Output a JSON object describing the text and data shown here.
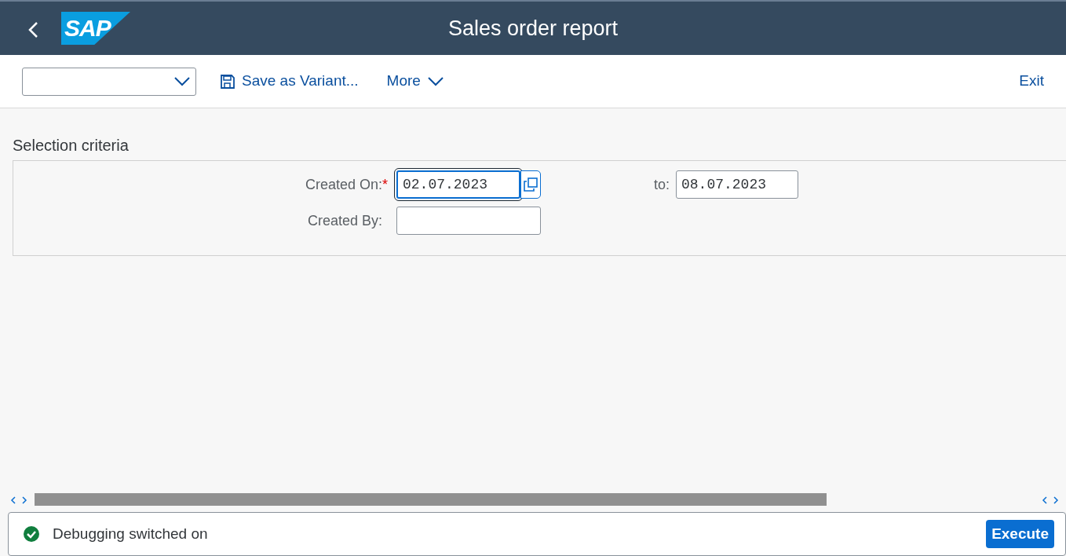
{
  "header": {
    "logo": "SAP",
    "title": "Sales order report"
  },
  "toolbar": {
    "actions": [
      {
        "kind": "save",
        "label": "Save as Variant..."
      },
      {
        "kind": "menu",
        "label": "More"
      }
    ],
    "exit": "Exit"
  },
  "section": {
    "title": "Selection criteria",
    "fields": [
      {
        "label": "Created On:",
        "required_mark": "*",
        "focused": true,
        "value": "02.07.2023",
        "value_help": true,
        "to_label": "to:",
        "to_value": "08.07.2023"
      },
      {
        "label": "Created By:",
        "focused": false
      }
    ]
  },
  "status_bar": {
    "kind": "success",
    "message": "Debugging switched on",
    "button": "Execute"
  }
}
